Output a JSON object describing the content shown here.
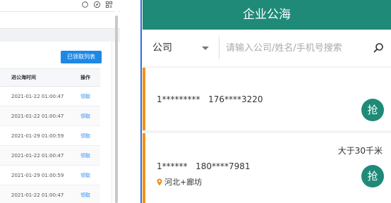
{
  "left_panel": {
    "claimed_list_button": "已领取列表",
    "columns": [
      "进公海时间",
      "操作"
    ],
    "rows": [
      {
        "time": "2021-01-22 01:00:47",
        "action": "领取"
      },
      {
        "time": "2021-01-22 01:00:47",
        "action": "领取"
      },
      {
        "time": "2021-01-29 01:00:59",
        "action": "领取"
      },
      {
        "time": "2021-01-22 01:00:47",
        "action": "领取"
      },
      {
        "time": "2021-01-29 01:00:59",
        "action": "领取"
      },
      {
        "time": "2021-01-22 01:00:47",
        "action": "领取"
      }
    ],
    "icons": [
      "refresh-icon",
      "compass-icon",
      "grid-icon"
    ]
  },
  "mobile": {
    "title": "企业公海",
    "filter_selected": "公司",
    "search_placeholder": "请输入公司/姓名/手机号搜索",
    "cards": [
      {
        "name": "1*********",
        "phone": "176****3220",
        "distance": "",
        "location": "",
        "grab": "抢"
      },
      {
        "name": "1******",
        "phone": "180****7981",
        "distance": "大于30千米",
        "location": "河北+廊坊",
        "grab": "抢"
      }
    ]
  },
  "colors": {
    "header": "#1f8a78",
    "accent_orange": "#f0921d",
    "link_blue": "#2d8cf0",
    "button_blue": "#1e88e5"
  }
}
